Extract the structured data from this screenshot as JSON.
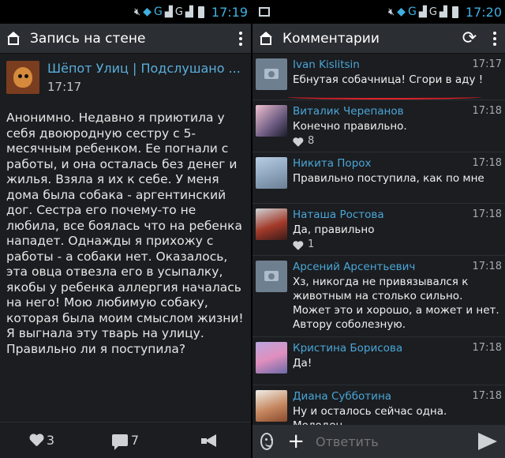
{
  "left": {
    "status": {
      "signal_1": "G",
      "signal_2": "G",
      "time": "17:19"
    },
    "title": "Запись на стене",
    "post": {
      "author": "Шёпот Улиц | Подслушано ...",
      "time": "17:17",
      "text": "Анонимно. Недавно я приютила у себя двоюродную сестру с 5-месячным ребенком. Ее погнали с работы, и она осталась без денег и жилья. Взяла я их к себе. У меня дома была собака - аргентинский дог. Сестра его почему-то не любила, все боялась что на ребенка нападет. Однажды я прихожу с работы - а собаки нет. Оказалось, эта овца отвезла его в усыпалку, якобы у ребенка аллергия началась на него! Мою любимую собаку, которая была моим смыслом жизни! Я выгнала эту тварь на улицу. Правильно ли я поступила?",
      "likes": "3",
      "comments": "7"
    }
  },
  "right": {
    "status": {
      "signal_1": "G",
      "signal_2": "G",
      "time": "17:20"
    },
    "title": "Комментарии",
    "comments": [
      {
        "name": "Ivan Kislitsin",
        "time": "17:17",
        "text": "Ебнутая собачница! Сгори в аду !",
        "likes": ""
      },
      {
        "name": "Виталик Черепанов",
        "time": "17:18",
        "text": "Конечно правильно.",
        "likes": "8"
      },
      {
        "name": "Никита Порох",
        "time": "17:18",
        "text": "Правильно поступила, как по мне",
        "likes": ""
      },
      {
        "name": "Наташа Ростова",
        "time": "17:18",
        "text": "Да, правильно",
        "likes": "1"
      },
      {
        "name": "Арсений Арсентьевич",
        "time": "17:18",
        "text": "Хз, никогда не привязывался к животным на столько сильно. Может это и хорошо, а может и нет. Автору соболезную.",
        "likes": ""
      },
      {
        "name": "Кристина Борисова",
        "time": "17:18",
        "text": "Да!",
        "likes": ""
      },
      {
        "name": "Диана Субботина",
        "time": "17:18",
        "text": "Ну и осталось сейчас одна. Молодец.",
        "likes": ""
      }
    ],
    "compose": {
      "placeholder": "Ответить"
    }
  },
  "colors": {
    "accent": "#4aa6d8",
    "annotation": "#e0202a"
  }
}
